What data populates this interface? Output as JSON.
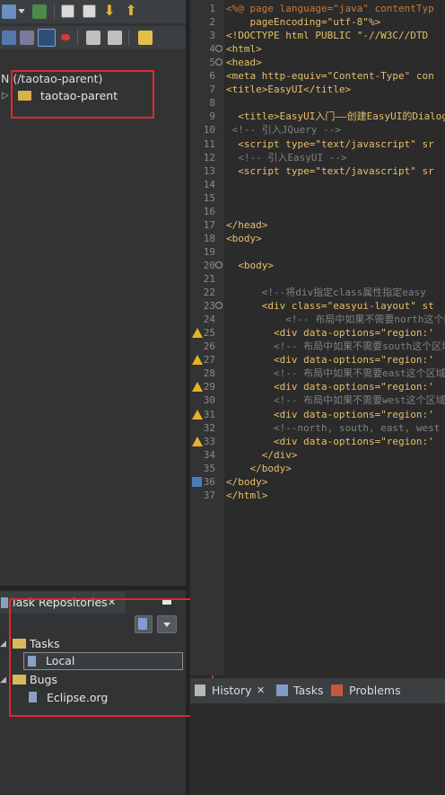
{
  "project_explorer": {
    "svn_header": "N (/taotao-parent)",
    "project_name": "taotao-parent"
  },
  "task_repositories": {
    "tab_label": "Task Repositories",
    "close_symbol": "✕",
    "groups": [
      {
        "label": "Tasks",
        "children": [
          "Local"
        ]
      },
      {
        "label": "Bugs",
        "children": [
          "Eclipse.org"
        ]
      }
    ]
  },
  "editor": {
    "line_numbers": [
      "1",
      "2",
      "3",
      "4",
      "5",
      "6",
      "7",
      "8",
      "9",
      "10",
      "11",
      "12",
      "13",
      "14",
      "15",
      "16",
      "17",
      "18",
      "19",
      "20",
      "21",
      "22",
      "23",
      "24",
      "25",
      "26",
      "27",
      "28",
      "29",
      "30",
      "31",
      "32",
      "33",
      "34",
      "35",
      "36",
      "37"
    ],
    "lines": [
      "<%@ page language=\"java\" contentTyp",
      "    pageEncoding=\"utf-8\"%>",
      "<!DOCTYPE html PUBLIC \"-//W3C//DTD",
      "<html>",
      "<head>",
      "<meta http-equiv=\"Content-Type\" con",
      "<title>EasyUI</title>",
      "",
      "  <title>EasyUI入门——创建EasyUI的Dialog",
      " <!-- 引入JQuery -->",
      "  <script type=\"text/javascript\" sr",
      "  <!-- 引入EasyUI -->",
      "  <script type=\"text/javascript\" sr",
      "",
      "",
      "",
      "</head>",
      "<body>",
      "",
      "  <body>",
      "",
      "      <!--将div指定class属性指定easy",
      "      <div class=\"easyui-layout\" st",
      "          <!-- 布局中如果不需要north这个区",
      "        <div data-options=\"region:'",
      "        <!-- 布局中如果不需要south这个区域.",
      "        <div data-options=\"region:'",
      "        <!-- 布局中如果不需要east这个区域,",
      "        <div data-options=\"region:'",
      "        <!-- 布局中如果不需要west这个区域,",
      "        <div data-options=\"region:'",
      "        <!--north, south, east, west",
      "        <div data-options=\"region:'",
      "      </div>",
      "    </body>",
      "</body>",
      "</html>"
    ]
  },
  "bottom_tabs": [
    {
      "label": "History",
      "close_symbol": "✕"
    },
    {
      "label": "Tasks"
    },
    {
      "label": "Problems"
    }
  ]
}
